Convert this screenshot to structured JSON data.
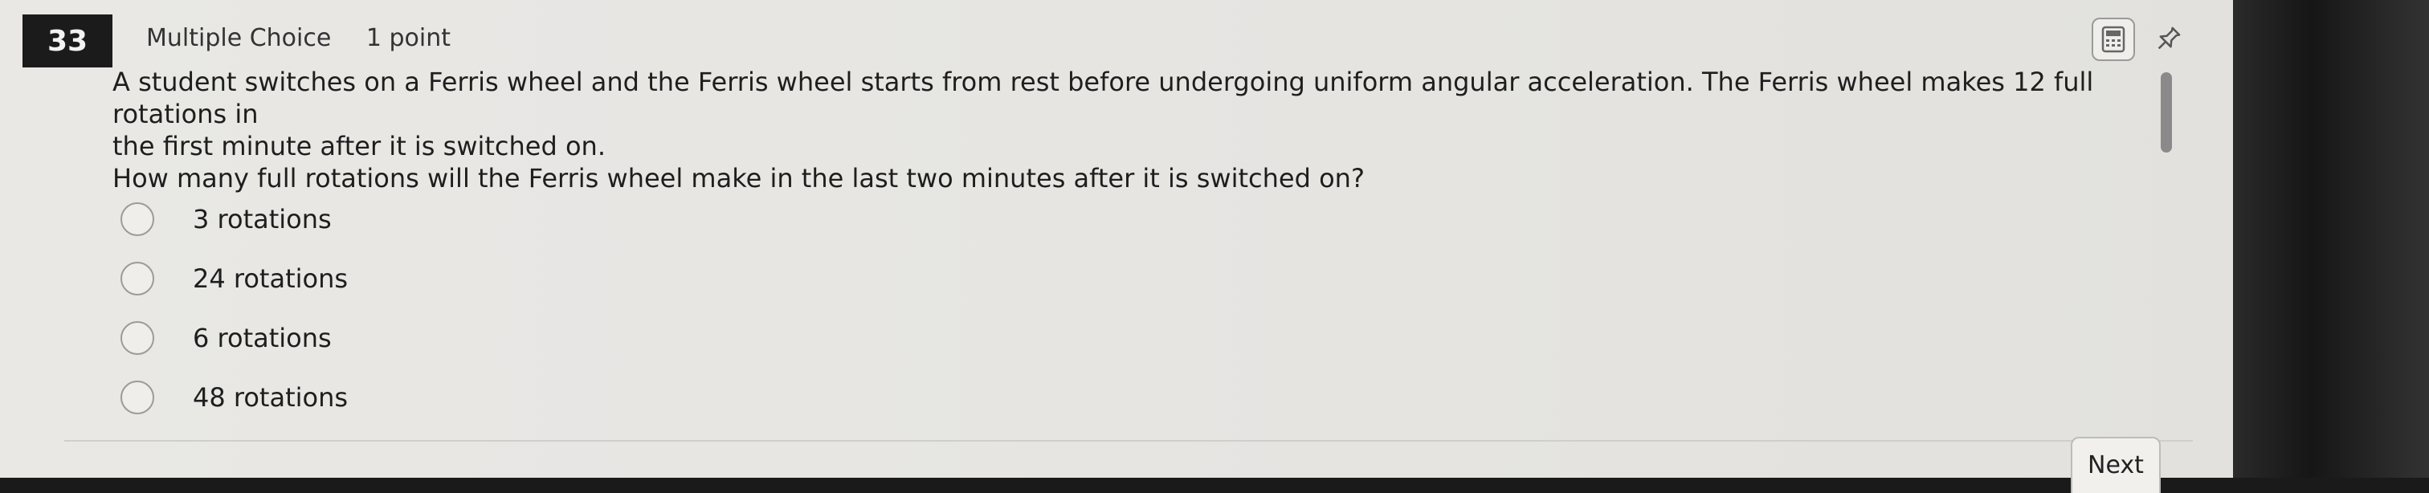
{
  "question": {
    "number": "33",
    "type": "Multiple Choice",
    "points": "1 point",
    "stem_line1": "A student switches on a Ferris wheel and the Ferris wheel starts from rest before undergoing uniform angular acceleration. The Ferris wheel makes 12 full rotations in",
    "stem_line2": "the first minute after it is switched on.",
    "stem_line3": "How many full rotations will the Ferris wheel make in the last two minutes after it is switched on?"
  },
  "options": [
    {
      "label": "3 rotations"
    },
    {
      "label": "24 rotations"
    },
    {
      "label": "6 rotations"
    },
    {
      "label": "48 rotations"
    }
  ],
  "tools": {
    "calculator_icon": "calculator-icon",
    "pin_icon": "pin-icon"
  },
  "navigation": {
    "next_label": "Next"
  },
  "colors": {
    "number_badge_bg": "#1b1b1b",
    "panel_bg": "#e7e6e3"
  }
}
